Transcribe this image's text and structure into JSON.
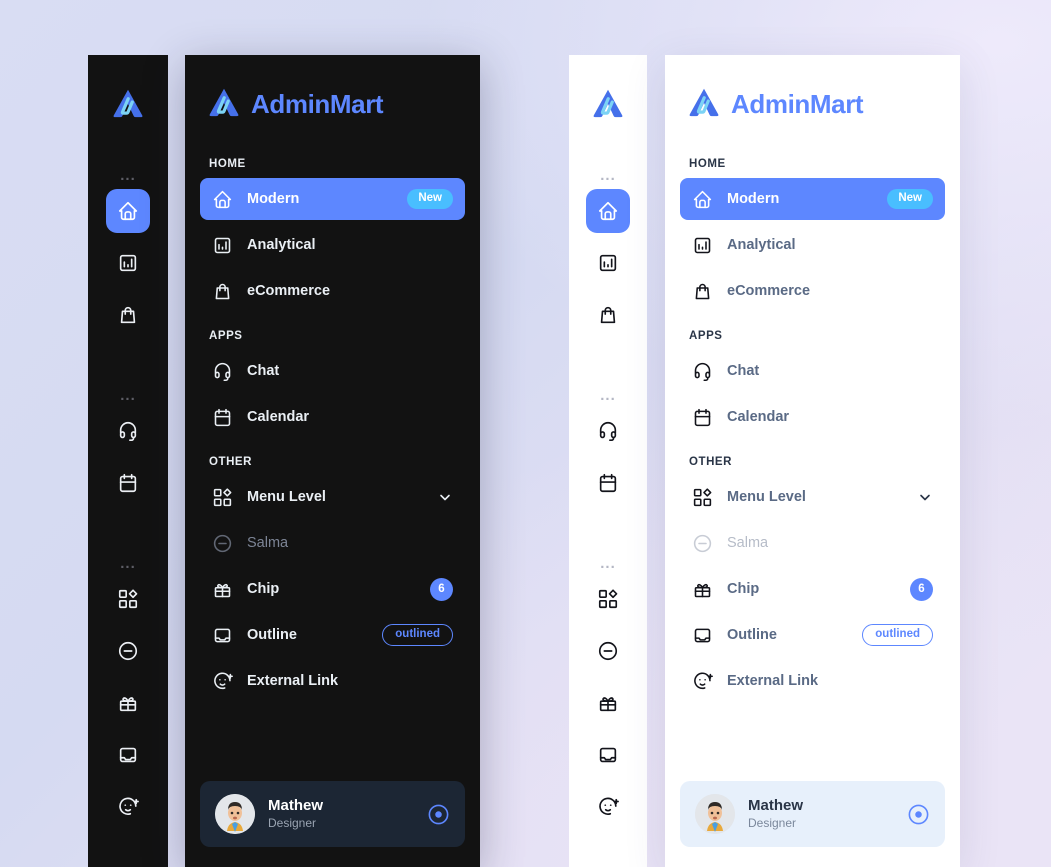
{
  "theme": {
    "accent": "#5d87ff",
    "badge_new_color": "#49beff",
    "dark_bg": "#121212",
    "light_bg": "#ffffff",
    "dark_card_bg": "#1c2634",
    "light_card_bg": "#e7f0fb",
    "page_bg": "#d6daf3"
  },
  "brand": {
    "name": "AdminMart",
    "logo_icon": "adminmart-logo-icon"
  },
  "mini_sidebar": {
    "divider_label": "...",
    "groups": [
      {
        "items": [
          {
            "icon": "home-icon",
            "active": true
          },
          {
            "icon": "chart-bar-icon",
            "active": false
          },
          {
            "icon": "shopping-bag-icon",
            "active": false
          }
        ]
      },
      {
        "items": [
          {
            "icon": "headset-icon",
            "active": false
          },
          {
            "icon": "calendar-icon",
            "active": false
          }
        ]
      },
      {
        "items": [
          {
            "icon": "grid-diamond-icon",
            "active": false
          },
          {
            "icon": "minus-circle-icon",
            "active": false
          },
          {
            "icon": "gift-icon",
            "active": false
          },
          {
            "icon": "inbox-icon",
            "active": false
          },
          {
            "icon": "mood-plus-icon",
            "active": false
          }
        ]
      }
    ]
  },
  "sidebar": {
    "sections": [
      {
        "caption": "HOME",
        "items": [
          {
            "label": "Modern",
            "icon": "home-icon",
            "active": true,
            "badge": {
              "type": "new",
              "text": "New"
            }
          },
          {
            "label": "Analytical",
            "icon": "chart-bar-icon",
            "active": false
          },
          {
            "label": "eCommerce",
            "icon": "shopping-bag-icon",
            "active": false
          }
        ]
      },
      {
        "caption": "APPS",
        "items": [
          {
            "label": "Chat",
            "icon": "headset-icon",
            "active": false
          },
          {
            "label": "Calendar",
            "icon": "calendar-icon",
            "active": false
          }
        ]
      },
      {
        "caption": "OTHER",
        "items": [
          {
            "label": "Menu Level",
            "icon": "grid-diamond-icon",
            "active": false,
            "badge": {
              "type": "chevron"
            }
          },
          {
            "label": "Salma",
            "icon": "minus-circle-icon",
            "active": false,
            "disabled": true
          },
          {
            "label": "Chip",
            "icon": "gift-icon",
            "active": false,
            "badge": {
              "type": "count",
              "text": "6"
            }
          },
          {
            "label": "Outline",
            "icon": "inbox-icon",
            "active": false,
            "badge": {
              "type": "outline",
              "text": "outlined"
            }
          },
          {
            "label": "External Link",
            "icon": "mood-plus-icon",
            "active": false
          }
        ]
      }
    ]
  },
  "profile": {
    "name": "Mathew",
    "role": "Designer",
    "avatar_icon": "user-avatar",
    "action_icon": "power-target-icon"
  }
}
